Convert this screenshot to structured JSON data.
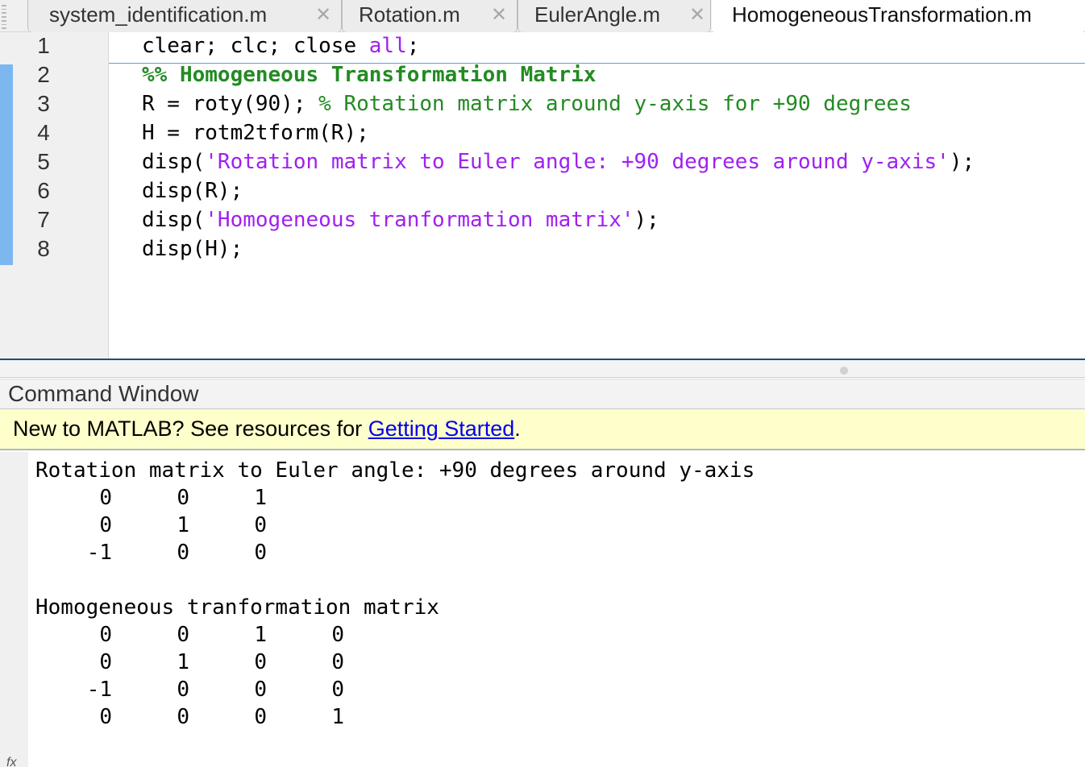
{
  "tabs": [
    {
      "label": "system_identification.m",
      "close": "✕"
    },
    {
      "label": "Rotation.m",
      "close": "✕"
    },
    {
      "label": "EulerAngle.m",
      "close": "✕"
    },
    {
      "label": "HomogeneousTransformation.m",
      "active": true
    }
  ],
  "editor": {
    "line_numbers": [
      "1",
      "2",
      "3",
      "4",
      "5",
      "6",
      "7",
      "8"
    ],
    "lines": {
      "l1_a": "clear; clc; close ",
      "l1_kw": "all",
      "l1_b": ";",
      "l2_cell": "%% Homogeneous Transformation Matrix",
      "l3_code": "R = roty(90); ",
      "l3_comment": "% Rotation matrix around y-axis for +90 degrees",
      "l4": "H = rotm2tform(R);",
      "l5_a": "disp(",
      "l5_str": "'Rotation matrix to Euler angle: +90 degrees around y-axis'",
      "l5_b": ");",
      "l6": "disp(R);",
      "l7_a": "disp(",
      "l7_str": "'Homogeneous tranformation matrix'",
      "l7_b": ");",
      "l8": "disp(H);"
    }
  },
  "command_window": {
    "title": "Command Window",
    "notice_prefix": "New to MATLAB? See resources for ",
    "notice_link": "Getting Started",
    "notice_suffix": ".",
    "prompt_symbol": "fx",
    "output1_title": "Rotation matrix to Euler angle: +90 degrees around y-axis",
    "matrix1": [
      [
        "0",
        "0",
        "1"
      ],
      [
        "0",
        "1",
        "0"
      ],
      [
        "-1",
        "0",
        "0"
      ]
    ],
    "output2_title": "Homogeneous tranformation matrix",
    "matrix2": [
      [
        "0",
        "0",
        "1",
        "0"
      ],
      [
        "0",
        "1",
        "0",
        "0"
      ],
      [
        "-1",
        "0",
        "0",
        "0"
      ],
      [
        "0",
        "0",
        "0",
        "1"
      ]
    ]
  }
}
